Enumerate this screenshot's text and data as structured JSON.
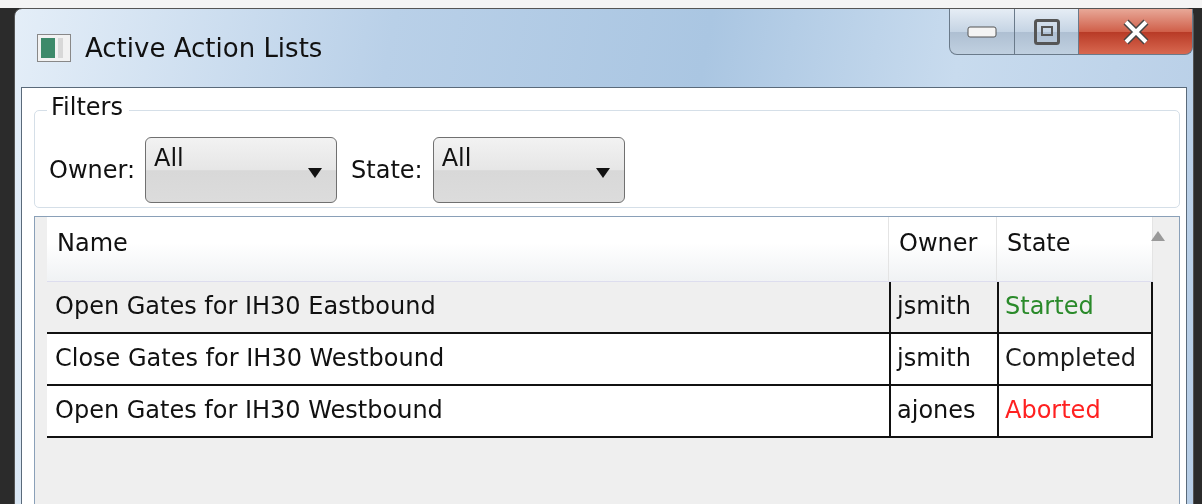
{
  "window": {
    "title": "Active Action Lists"
  },
  "filters": {
    "title": "Filters",
    "fields": [
      {
        "label": "Owner:",
        "value": "All"
      },
      {
        "label": "State:",
        "value": "All"
      }
    ]
  },
  "table": {
    "columns": [
      "Name",
      "Owner",
      "State"
    ],
    "rows": [
      {
        "name": "Open Gates for IH30 Eastbound",
        "owner": "jsmith",
        "state": "Started",
        "color": "#2a8a2a",
        "selected": true
      },
      {
        "name": "Close Gates for IH30 Westbound",
        "owner": "jsmith",
        "state": "Completed",
        "color": "#1a1a1a",
        "selected": false
      },
      {
        "name": "Open Gates for IH30 Westbound",
        "owner": "ajones",
        "state": "Aborted",
        "color": "#ff2020",
        "selected": false
      }
    ]
  }
}
